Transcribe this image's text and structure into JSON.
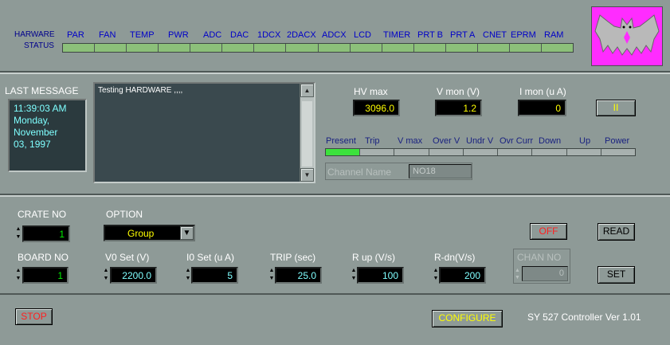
{
  "hardware_status": {
    "label_line1": "HARWARE",
    "label_line2": "STATUS",
    "items": [
      "PAR",
      "FAN",
      "TEMP",
      "PWR",
      "ADC",
      "DAC",
      "1DCX",
      "2DACX",
      "ADCX",
      "LCD",
      "TIMER",
      "PRT B",
      "PRT A",
      "CNET",
      "EPRM",
      "RAM"
    ]
  },
  "logo": {
    "icon": "bat-logo-icon",
    "background": "#ff2cff"
  },
  "last_message": {
    "label": "LAST MESSAGE",
    "lines": [
      "11:39:03 AM",
      "Monday,",
      "November",
      "03, 1997"
    ]
  },
  "message_log": {
    "text": "Testing HARDWARE ,,,,"
  },
  "hv_max": {
    "label": "HV max",
    "value": "3096.0"
  },
  "v_mon": {
    "label": "V mon (V)",
    "value": "1.2"
  },
  "i_mon": {
    "label": "I mon (u A)",
    "value": "0"
  },
  "pause_button": {
    "label": "II"
  },
  "channel_status": {
    "items": [
      "Present",
      "Trip",
      "V max",
      "Over V",
      "Undr V",
      "Ovr Curr",
      "Down",
      "Up",
      "Power"
    ],
    "lit_index": 0
  },
  "channel_name": {
    "label": "Channel Name",
    "value": "NO18"
  },
  "crate_no": {
    "label": "CRATE NO",
    "value": "1"
  },
  "option": {
    "label": "OPTION",
    "value": "Group"
  },
  "off_button": {
    "label": "OFF"
  },
  "read_button": {
    "label": "READ"
  },
  "set_button": {
    "label": "SET"
  },
  "board_no": {
    "label": "BOARD NO",
    "value": "1"
  },
  "v0_set": {
    "label": "V0 Set  (V)",
    "value": "2200.0"
  },
  "i0_set": {
    "label": "I0 Set  (u A)",
    "value": "5"
  },
  "trip": {
    "label": "TRIP (sec)",
    "value": "25.0"
  },
  "r_up": {
    "label": "R up (V/s)",
    "value": "100"
  },
  "r_dn": {
    "label": "R-dn(V/s)",
    "value": "200"
  },
  "chan_no": {
    "label": "CHAN NO",
    "value": "0"
  },
  "stop_button": {
    "label": "STOP"
  },
  "configure_button": {
    "label": "CONFIGURE"
  },
  "version": {
    "text": "SY 527 Controller  Ver 1.01"
  },
  "colors": {
    "background": "#8e9a97",
    "digital_yellow": "#ffff00",
    "digital_green": "#00ee00",
    "digital_cyan": "#80ffff",
    "alert_red": "#ff2020"
  }
}
